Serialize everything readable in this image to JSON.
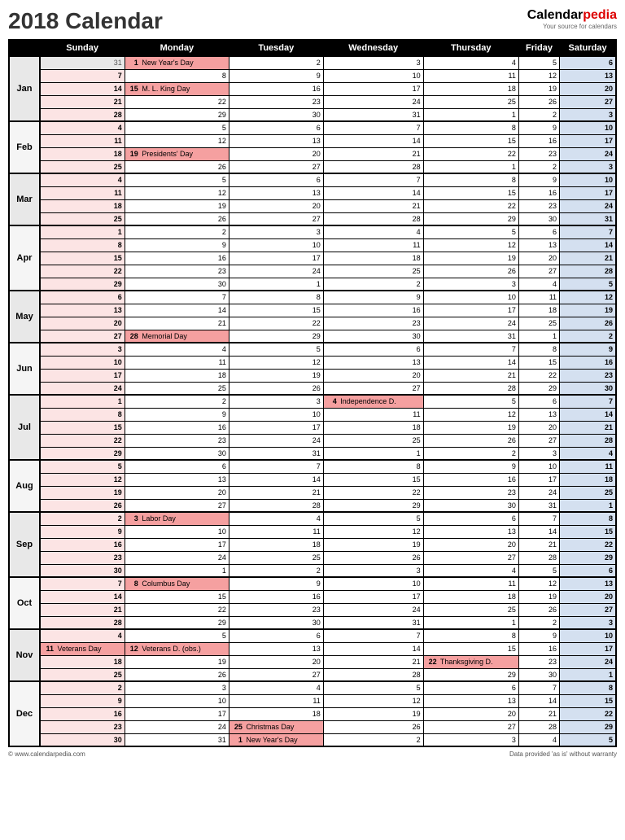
{
  "title": "2018 Calendar",
  "logo": {
    "brand1": "Calendar",
    "brand2": "pedia",
    "tagline": "Your source for calendars"
  },
  "footer": {
    "left": "© www.calendarpedia.com",
    "right": "Data provided 'as is' without warranty"
  },
  "days": [
    "Sunday",
    "Monday",
    "Tuesday",
    "Wednesday",
    "Thursday",
    "Friday",
    "Saturday"
  ],
  "months": [
    "Jan",
    "Feb",
    "Mar",
    "Apr",
    "May",
    "Jun",
    "Jul",
    "Aug",
    "Sep",
    "Oct",
    "Nov",
    "Dec"
  ],
  "rows": [
    {
      "m": 0,
      "first": true,
      "c": [
        {
          "d": 31,
          "g": 1
        },
        {
          "d": 1,
          "h": "New Year's Day"
        },
        {
          "d": 2
        },
        {
          "d": 3
        },
        {
          "d": 4
        },
        {
          "d": 5
        },
        {
          "d": 6
        }
      ]
    },
    {
      "m": 0,
      "c": [
        {
          "d": 7
        },
        {
          "d": 8
        },
        {
          "d": 9
        },
        {
          "d": 10
        },
        {
          "d": 11
        },
        {
          "d": 12
        },
        {
          "d": 13
        }
      ]
    },
    {
      "m": 0,
      "label": 1,
      "c": [
        {
          "d": 14
        },
        {
          "d": 15,
          "h": "M. L. King Day"
        },
        {
          "d": 16
        },
        {
          "d": 17
        },
        {
          "d": 18
        },
        {
          "d": 19
        },
        {
          "d": 20
        }
      ]
    },
    {
      "m": 0,
      "c": [
        {
          "d": 21
        },
        {
          "d": 22
        },
        {
          "d": 23
        },
        {
          "d": 24
        },
        {
          "d": 25
        },
        {
          "d": 26
        },
        {
          "d": 27
        }
      ]
    },
    {
      "m": 0,
      "c": [
        {
          "d": 28
        },
        {
          "d": 29
        },
        {
          "d": 30
        },
        {
          "d": 31
        },
        {
          "d": 1
        },
        {
          "d": 2
        },
        {
          "d": 3
        }
      ]
    },
    {
      "m": 1,
      "first": true,
      "c": [
        {
          "d": 4
        },
        {
          "d": 5
        },
        {
          "d": 6
        },
        {
          "d": 7
        },
        {
          "d": 8
        },
        {
          "d": 9
        },
        {
          "d": 10
        }
      ]
    },
    {
      "m": 1,
      "label": 1,
      "c": [
        {
          "d": 11
        },
        {
          "d": 12
        },
        {
          "d": 13
        },
        {
          "d": 14
        },
        {
          "d": 15
        },
        {
          "d": 16
        },
        {
          "d": 17
        }
      ]
    },
    {
      "m": 1,
      "c": [
        {
          "d": 18
        },
        {
          "d": 19,
          "h": "Presidents' Day"
        },
        {
          "d": 20
        },
        {
          "d": 21
        },
        {
          "d": 22
        },
        {
          "d": 23
        },
        {
          "d": 24
        }
      ]
    },
    {
      "m": 1,
      "c": [
        {
          "d": 25
        },
        {
          "d": 26
        },
        {
          "d": 27
        },
        {
          "d": 28
        },
        {
          "d": 1
        },
        {
          "d": 2
        },
        {
          "d": 3
        }
      ]
    },
    {
      "m": 2,
      "first": true,
      "c": [
        {
          "d": 4
        },
        {
          "d": 5
        },
        {
          "d": 6
        },
        {
          "d": 7
        },
        {
          "d": 8
        },
        {
          "d": 9
        },
        {
          "d": 10
        }
      ]
    },
    {
      "m": 2,
      "label": 1,
      "c": [
        {
          "d": 11
        },
        {
          "d": 12
        },
        {
          "d": 13
        },
        {
          "d": 14
        },
        {
          "d": 15
        },
        {
          "d": 16
        },
        {
          "d": 17
        }
      ]
    },
    {
      "m": 2,
      "c": [
        {
          "d": 18
        },
        {
          "d": 19
        },
        {
          "d": 20
        },
        {
          "d": 21
        },
        {
          "d": 22
        },
        {
          "d": 23
        },
        {
          "d": 24
        }
      ]
    },
    {
      "m": 2,
      "c": [
        {
          "d": 25
        },
        {
          "d": 26
        },
        {
          "d": 27
        },
        {
          "d": 28
        },
        {
          "d": 29
        },
        {
          "d": 30
        },
        {
          "d": 31
        }
      ]
    },
    {
      "m": 3,
      "first": true,
      "c": [
        {
          "d": 1
        },
        {
          "d": 2
        },
        {
          "d": 3
        },
        {
          "d": 4
        },
        {
          "d": 5
        },
        {
          "d": 6
        },
        {
          "d": 7
        }
      ]
    },
    {
      "m": 3,
      "c": [
        {
          "d": 8
        },
        {
          "d": 9
        },
        {
          "d": 10
        },
        {
          "d": 11
        },
        {
          "d": 12
        },
        {
          "d": 13
        },
        {
          "d": 14
        }
      ]
    },
    {
      "m": 3,
      "label": 1,
      "c": [
        {
          "d": 15
        },
        {
          "d": 16
        },
        {
          "d": 17
        },
        {
          "d": 18
        },
        {
          "d": 19
        },
        {
          "d": 20
        },
        {
          "d": 21
        }
      ]
    },
    {
      "m": 3,
      "c": [
        {
          "d": 22
        },
        {
          "d": 23
        },
        {
          "d": 24
        },
        {
          "d": 25
        },
        {
          "d": 26
        },
        {
          "d": 27
        },
        {
          "d": 28
        }
      ]
    },
    {
      "m": 3,
      "c": [
        {
          "d": 29
        },
        {
          "d": 30
        },
        {
          "d": 1
        },
        {
          "d": 2
        },
        {
          "d": 3
        },
        {
          "d": 4
        },
        {
          "d": 5
        }
      ]
    },
    {
      "m": 4,
      "first": true,
      "c": [
        {
          "d": 6
        },
        {
          "d": 7
        },
        {
          "d": 8
        },
        {
          "d": 9
        },
        {
          "d": 10
        },
        {
          "d": 11
        },
        {
          "d": 12
        }
      ]
    },
    {
      "m": 4,
      "label": 1,
      "c": [
        {
          "d": 13
        },
        {
          "d": 14
        },
        {
          "d": 15
        },
        {
          "d": 16
        },
        {
          "d": 17
        },
        {
          "d": 18
        },
        {
          "d": 19
        }
      ]
    },
    {
      "m": 4,
      "c": [
        {
          "d": 20
        },
        {
          "d": 21
        },
        {
          "d": 22
        },
        {
          "d": 23
        },
        {
          "d": 24
        },
        {
          "d": 25
        },
        {
          "d": 26
        }
      ]
    },
    {
      "m": 4,
      "c": [
        {
          "d": 27
        },
        {
          "d": 28,
          "h": "Memorial Day"
        },
        {
          "d": 29
        },
        {
          "d": 30
        },
        {
          "d": 31
        },
        {
          "d": 1
        },
        {
          "d": 2
        }
      ]
    },
    {
      "m": 5,
      "first": true,
      "c": [
        {
          "d": 3
        },
        {
          "d": 4
        },
        {
          "d": 5
        },
        {
          "d": 6
        },
        {
          "d": 7
        },
        {
          "d": 8
        },
        {
          "d": 9
        }
      ]
    },
    {
      "m": 5,
      "label": 1,
      "c": [
        {
          "d": 10
        },
        {
          "d": 11
        },
        {
          "d": 12
        },
        {
          "d": 13
        },
        {
          "d": 14
        },
        {
          "d": 15
        },
        {
          "d": 16
        }
      ]
    },
    {
      "m": 5,
      "c": [
        {
          "d": 17
        },
        {
          "d": 18
        },
        {
          "d": 19
        },
        {
          "d": 20
        },
        {
          "d": 21
        },
        {
          "d": 22
        },
        {
          "d": 23
        }
      ]
    },
    {
      "m": 5,
      "c": [
        {
          "d": 24
        },
        {
          "d": 25
        },
        {
          "d": 26
        },
        {
          "d": 27
        },
        {
          "d": 28
        },
        {
          "d": 29
        },
        {
          "d": 30
        }
      ]
    },
    {
      "m": 6,
      "first": true,
      "c": [
        {
          "d": 1
        },
        {
          "d": 2
        },
        {
          "d": 3
        },
        {
          "d": 4,
          "h": "Independence D."
        },
        {
          "d": 5
        },
        {
          "d": 6
        },
        {
          "d": 7
        }
      ]
    },
    {
      "m": 6,
      "c": [
        {
          "d": 8
        },
        {
          "d": 9
        },
        {
          "d": 10
        },
        {
          "d": 11
        },
        {
          "d": 12
        },
        {
          "d": 13
        },
        {
          "d": 14
        }
      ]
    },
    {
      "m": 6,
      "label": 1,
      "c": [
        {
          "d": 15
        },
        {
          "d": 16
        },
        {
          "d": 17
        },
        {
          "d": 18
        },
        {
          "d": 19
        },
        {
          "d": 20
        },
        {
          "d": 21
        }
      ]
    },
    {
      "m": 6,
      "c": [
        {
          "d": 22
        },
        {
          "d": 23
        },
        {
          "d": 24
        },
        {
          "d": 25
        },
        {
          "d": 26
        },
        {
          "d": 27
        },
        {
          "d": 28
        }
      ]
    },
    {
      "m": 6,
      "c": [
        {
          "d": 29
        },
        {
          "d": 30
        },
        {
          "d": 31
        },
        {
          "d": 1
        },
        {
          "d": 2
        },
        {
          "d": 3
        },
        {
          "d": 4
        }
      ]
    },
    {
      "m": 7,
      "first": true,
      "c": [
        {
          "d": 5
        },
        {
          "d": 6
        },
        {
          "d": 7
        },
        {
          "d": 8
        },
        {
          "d": 9
        },
        {
          "d": 10
        },
        {
          "d": 11
        }
      ]
    },
    {
      "m": 7,
      "label": 1,
      "c": [
        {
          "d": 12
        },
        {
          "d": 13
        },
        {
          "d": 14
        },
        {
          "d": 15
        },
        {
          "d": 16
        },
        {
          "d": 17
        },
        {
          "d": 18
        }
      ]
    },
    {
      "m": 7,
      "c": [
        {
          "d": 19
        },
        {
          "d": 20
        },
        {
          "d": 21
        },
        {
          "d": 22
        },
        {
          "d": 23
        },
        {
          "d": 24
        },
        {
          "d": 25
        }
      ]
    },
    {
      "m": 7,
      "c": [
        {
          "d": 26
        },
        {
          "d": 27
        },
        {
          "d": 28
        },
        {
          "d": 29
        },
        {
          "d": 30
        },
        {
          "d": 31
        },
        {
          "d": 1
        }
      ]
    },
    {
      "m": 8,
      "first": true,
      "c": [
        {
          "d": 2
        },
        {
          "d": 3,
          "h": "Labor Day"
        },
        {
          "d": 4
        },
        {
          "d": 5
        },
        {
          "d": 6
        },
        {
          "d": 7
        },
        {
          "d": 8
        }
      ]
    },
    {
      "m": 8,
      "c": [
        {
          "d": 9
        },
        {
          "d": 10
        },
        {
          "d": 11
        },
        {
          "d": 12
        },
        {
          "d": 13
        },
        {
          "d": 14
        },
        {
          "d": 15
        }
      ]
    },
    {
      "m": 8,
      "label": 1,
      "c": [
        {
          "d": 16
        },
        {
          "d": 17
        },
        {
          "d": 18
        },
        {
          "d": 19
        },
        {
          "d": 20
        },
        {
          "d": 21
        },
        {
          "d": 22
        }
      ]
    },
    {
      "m": 8,
      "c": [
        {
          "d": 23
        },
        {
          "d": 24
        },
        {
          "d": 25
        },
        {
          "d": 26
        },
        {
          "d": 27
        },
        {
          "d": 28
        },
        {
          "d": 29
        }
      ]
    },
    {
      "m": 8,
      "c": [
        {
          "d": 30
        },
        {
          "d": 1
        },
        {
          "d": 2
        },
        {
          "d": 3
        },
        {
          "d": 4
        },
        {
          "d": 5
        },
        {
          "d": 6
        }
      ]
    },
    {
      "m": 9,
      "first": true,
      "c": [
        {
          "d": 7
        },
        {
          "d": 8,
          "h": "Columbus Day"
        },
        {
          "d": 9
        },
        {
          "d": 10
        },
        {
          "d": 11
        },
        {
          "d": 12
        },
        {
          "d": 13
        }
      ]
    },
    {
      "m": 9,
      "label": 1,
      "c": [
        {
          "d": 14
        },
        {
          "d": 15
        },
        {
          "d": 16
        },
        {
          "d": 17
        },
        {
          "d": 18
        },
        {
          "d": 19
        },
        {
          "d": 20
        }
      ]
    },
    {
      "m": 9,
      "c": [
        {
          "d": 21
        },
        {
          "d": 22
        },
        {
          "d": 23
        },
        {
          "d": 24
        },
        {
          "d": 25
        },
        {
          "d": 26
        },
        {
          "d": 27
        }
      ]
    },
    {
      "m": 9,
      "c": [
        {
          "d": 28
        },
        {
          "d": 29
        },
        {
          "d": 30
        },
        {
          "d": 31
        },
        {
          "d": 1
        },
        {
          "d": 2
        },
        {
          "d": 3
        }
      ]
    },
    {
      "m": 10,
      "first": true,
      "c": [
        {
          "d": 4
        },
        {
          "d": 5
        },
        {
          "d": 6
        },
        {
          "d": 7
        },
        {
          "d": 8
        },
        {
          "d": 9
        },
        {
          "d": 10
        }
      ]
    },
    {
      "m": 10,
      "label": 1,
      "c": [
        {
          "d": 11,
          "h": "Veterans Day"
        },
        {
          "d": 12,
          "h": "Veterans D. (obs.)"
        },
        {
          "d": 13
        },
        {
          "d": 14
        },
        {
          "d": 15
        },
        {
          "d": 16
        },
        {
          "d": 17
        }
      ]
    },
    {
      "m": 10,
      "c": [
        {
          "d": 18
        },
        {
          "d": 19
        },
        {
          "d": 20
        },
        {
          "d": 21
        },
        {
          "d": 22,
          "h": "Thanksgiving D."
        },
        {
          "d": 23
        },
        {
          "d": 24
        }
      ]
    },
    {
      "m": 10,
      "c": [
        {
          "d": 25
        },
        {
          "d": 26
        },
        {
          "d": 27
        },
        {
          "d": 28
        },
        {
          "d": 29
        },
        {
          "d": 30
        },
        {
          "d": 1
        }
      ]
    },
    {
      "m": 11,
      "first": true,
      "c": [
        {
          "d": 2
        },
        {
          "d": 3
        },
        {
          "d": 4
        },
        {
          "d": 5
        },
        {
          "d": 6
        },
        {
          "d": 7
        },
        {
          "d": 8
        }
      ]
    },
    {
      "m": 11,
      "c": [
        {
          "d": 9
        },
        {
          "d": 10
        },
        {
          "d": 11
        },
        {
          "d": 12
        },
        {
          "d": 13
        },
        {
          "d": 14
        },
        {
          "d": 15
        }
      ]
    },
    {
      "m": 11,
      "label": 1,
      "c": [
        {
          "d": 16
        },
        {
          "d": 17
        },
        {
          "d": 18
        },
        {
          "d": 19
        },
        {
          "d": 20
        },
        {
          "d": 21
        },
        {
          "d": 22
        }
      ]
    },
    {
      "m": 11,
      "c": [
        {
          "d": 23
        },
        {
          "d": 24
        },
        {
          "d": 25,
          "h": "Christmas Day"
        },
        {
          "d": 26
        },
        {
          "d": 27
        },
        {
          "d": 28
        },
        {
          "d": 29
        }
      ]
    },
    {
      "m": 11,
      "c": [
        {
          "d": 30
        },
        {
          "d": 31
        },
        {
          "d": 1,
          "h": "New Year's Day"
        },
        {
          "d": 2
        },
        {
          "d": 3
        },
        {
          "d": 4
        },
        {
          "d": 5
        }
      ]
    }
  ]
}
